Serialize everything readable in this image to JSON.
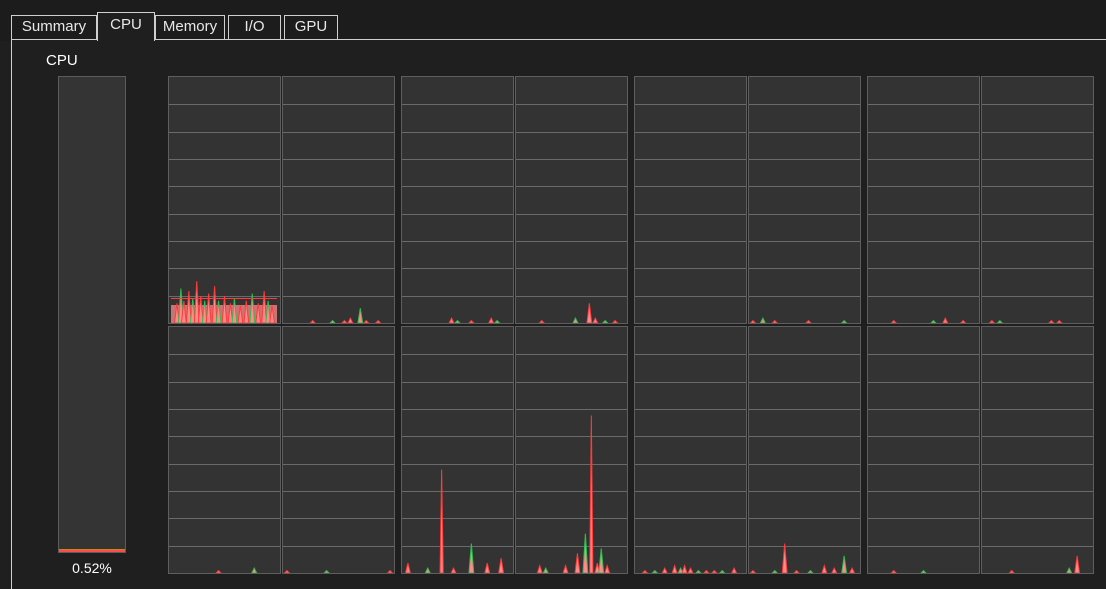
{
  "tabs": [
    {
      "label": "Summary",
      "active": false
    },
    {
      "label": "CPU",
      "active": true
    },
    {
      "label": "Memory",
      "active": false
    },
    {
      "label": "I/O",
      "active": false
    },
    {
      "label": "GPU",
      "active": false
    }
  ],
  "cpu": {
    "label": "CPU",
    "total_usage_text": "0.52%",
    "total_usage_fraction": 0.0052
  },
  "colors": {
    "kernel": "#ff3b3b",
    "kernel_fill": "#ff8a8a",
    "user": "#2fbf4f",
    "graph_bg": "#333333",
    "grid": "#6a6a6a"
  },
  "chart_data": {
    "type": "area",
    "description_rows": 2,
    "gridlines": true,
    "ylim": [
      0,
      100
    ],
    "series": [
      {
        "core": 0,
        "peaks": [
          [
            8,
            8
          ],
          [
            12,
            14
          ],
          [
            15,
            9
          ],
          [
            20,
            13
          ],
          [
            24,
            10
          ],
          [
            28,
            17
          ],
          [
            32,
            11
          ],
          [
            36,
            9
          ],
          [
            40,
            12
          ],
          [
            46,
            15
          ],
          [
            50,
            9
          ],
          [
            56,
            11
          ],
          [
            62,
            8
          ],
          [
            66,
            10
          ],
          [
            72,
            7
          ],
          [
            78,
            9
          ],
          [
            84,
            12
          ],
          [
            90,
            8
          ],
          [
            96,
            13
          ],
          [
            100,
            9
          ],
          [
            104,
            7
          ]
        ]
      },
      {
        "core": 1,
        "peaks": [
          [
            30,
            1
          ],
          [
            50,
            1
          ],
          [
            62,
            1
          ],
          [
            68,
            2
          ],
          [
            78,
            6
          ],
          [
            84,
            1
          ],
          [
            96,
            1
          ]
        ]
      },
      {
        "core": 2,
        "peaks": [
          [
            50,
            2
          ],
          [
            56,
            1
          ],
          [
            70,
            1
          ],
          [
            90,
            2
          ],
          [
            96,
            1
          ]
        ]
      },
      {
        "core": 3,
        "peaks": [
          [
            26,
            1
          ],
          [
            60,
            2
          ],
          [
            74,
            8
          ],
          [
            80,
            2
          ],
          [
            90,
            1
          ],
          [
            100,
            1
          ]
        ]
      },
      {
        "core": 4,
        "peaks": []
      },
      {
        "core": 5,
        "peaks": [
          [
            4,
            1
          ],
          [
            14,
            2
          ],
          [
            26,
            1
          ],
          [
            60,
            1
          ],
          [
            96,
            1
          ]
        ]
      },
      {
        "core": 6,
        "peaks": [
          [
            26,
            1
          ],
          [
            66,
            1
          ],
          [
            78,
            2
          ],
          [
            96,
            1
          ]
        ]
      },
      {
        "core": 7,
        "peaks": [
          [
            10,
            1
          ],
          [
            18,
            1
          ],
          [
            70,
            1
          ],
          [
            78,
            1
          ]
        ]
      },
      {
        "core": 8,
        "peaks": [
          [
            50,
            1
          ],
          [
            86,
            2
          ]
        ]
      },
      {
        "core": 9,
        "peaks": [
          [
            4,
            1
          ],
          [
            44,
            1
          ],
          [
            108,
            1
          ]
        ]
      },
      {
        "core": 10,
        "peaks": [
          [
            6,
            4
          ],
          [
            26,
            2
          ],
          [
            40,
            42
          ],
          [
            52,
            2
          ],
          [
            70,
            12
          ],
          [
            86,
            4
          ],
          [
            100,
            6
          ]
        ]
      },
      {
        "core": 11,
        "peaks": [
          [
            24,
            3
          ],
          [
            30,
            2
          ],
          [
            50,
            3
          ],
          [
            62,
            8
          ],
          [
            70,
            16
          ],
          [
            76,
            64
          ],
          [
            82,
            4
          ],
          [
            86,
            10
          ],
          [
            92,
            3
          ]
        ]
      },
      {
        "core": 12,
        "peaks": [
          [
            10,
            1
          ],
          [
            20,
            1
          ],
          [
            30,
            2
          ],
          [
            40,
            3
          ],
          [
            46,
            2
          ],
          [
            50,
            3
          ],
          [
            56,
            2
          ],
          [
            64,
            1
          ],
          [
            72,
            1
          ],
          [
            80,
            1
          ],
          [
            88,
            1
          ],
          [
            100,
            2
          ]
        ]
      },
      {
        "core": 13,
        "peaks": [
          [
            4,
            1
          ],
          [
            26,
            1
          ],
          [
            36,
            12
          ],
          [
            48,
            1
          ],
          [
            62,
            1
          ],
          [
            76,
            3
          ],
          [
            86,
            2
          ],
          [
            96,
            7
          ],
          [
            104,
            2
          ]
        ]
      },
      {
        "core": 14,
        "peaks": [
          [
            26,
            1
          ],
          [
            56,
            1
          ]
        ]
      },
      {
        "core": 15,
        "peaks": [
          [
            30,
            1
          ],
          [
            88,
            2
          ],
          [
            96,
            7
          ]
        ]
      }
    ]
  }
}
